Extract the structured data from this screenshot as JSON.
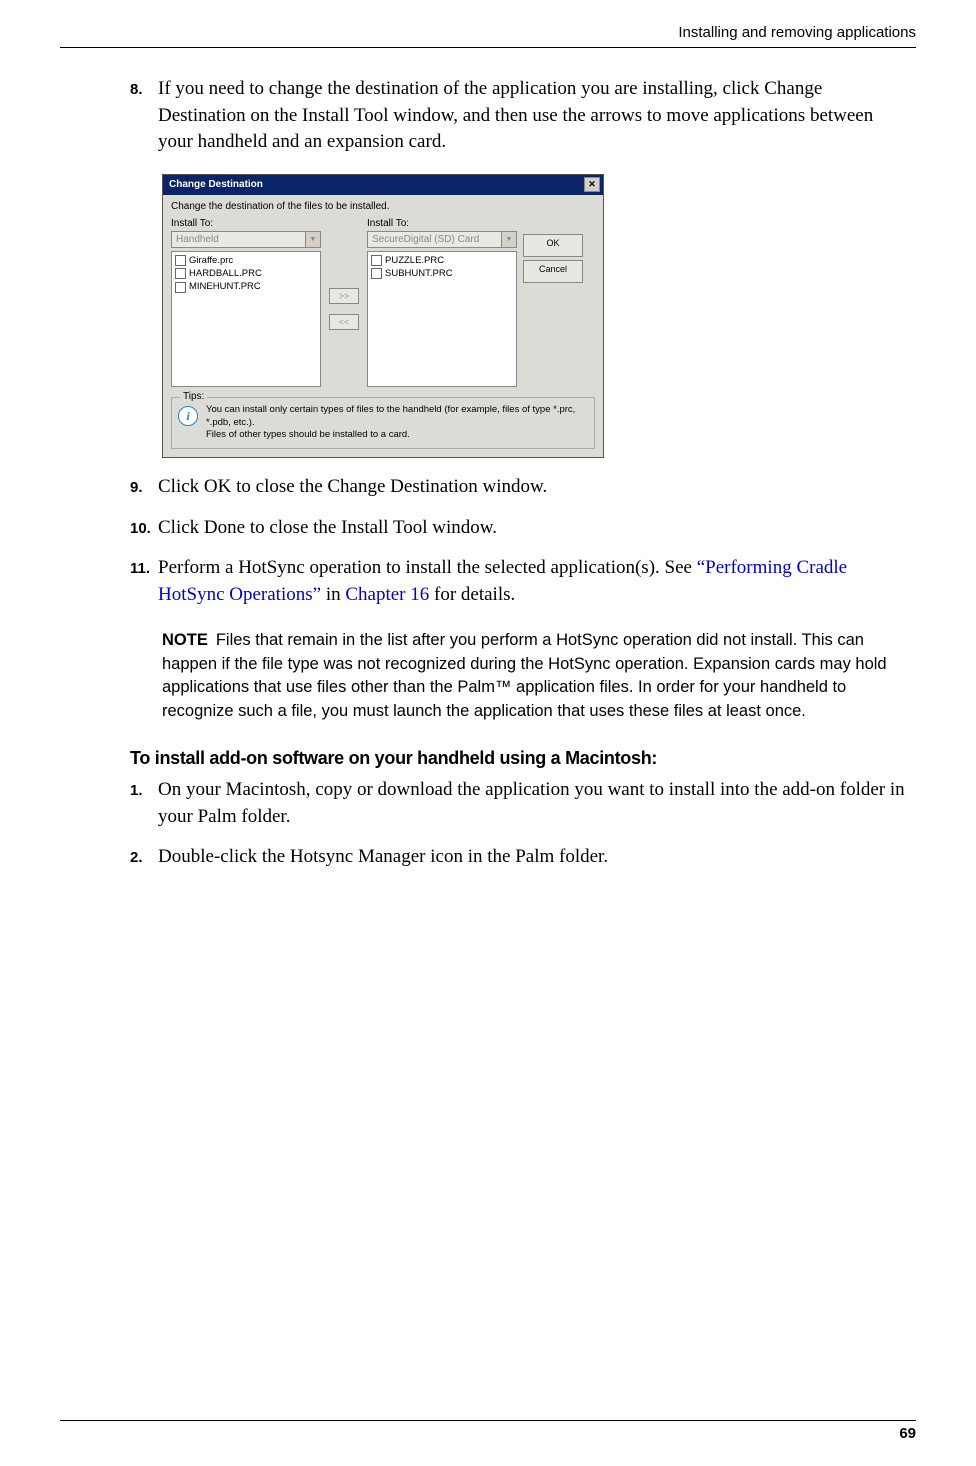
{
  "header": {
    "running_title": "Installing and removing applications"
  },
  "steps_a": [
    {
      "num": "8.",
      "text": "If you need to change the destination of the application you are installing, click Change Destination on the Install Tool window, and then use the arrows to move applications between your handheld and an expansion card."
    }
  ],
  "dialog": {
    "title": "Change Destination",
    "instruction": "Change the destination of the files to be installed.",
    "left_label": "Install To:",
    "right_label": "Install To:",
    "left_combo": "Handheld",
    "right_combo": "SecureDigital (SD) Card",
    "left_files": [
      "Giraffe.prc",
      "HARDBALL.PRC",
      "MINEHUNT.PRC"
    ],
    "right_files": [
      "PUZZLE.PRC",
      "SUBHUNT.PRC"
    ],
    "btn_right": ">>",
    "btn_left": "<<",
    "ok": "OK",
    "cancel": "Cancel",
    "tips_legend": "Tips:",
    "tips_line1": "You can install only certain types of files to the handheld (for example, files of type *.prc, *.pdb, etc.).",
    "tips_line2": "Files of other types should be installed to a card.",
    "close_glyph": "✕"
  },
  "steps_b": [
    {
      "num": "9.",
      "text": "Click OK to close the Change Destination window."
    },
    {
      "num": "10.",
      "text": "Click Done to close the Install Tool window."
    },
    {
      "num": "11.",
      "pre": "Perform a HotSync operation to install the selected application(s). See ",
      "link1": "“Performing Cradle HotSync Operations”",
      "mid": " in ",
      "link2": "Chapter 16",
      "post": " for details."
    }
  ],
  "note": {
    "label": "NOTE",
    "text": "Files that remain in the list after you perform a HotSync operation did not install. This can happen if the file type was not recognized during the HotSync operation. Expansion cards may hold applications that use files other than the Palm™ application files. In order for your handheld to recognize such a file, you must launch the application that uses these files at least once."
  },
  "subheading": "To install add-on software on your handheld using a Macintosh:",
  "steps_c": [
    {
      "num": "1.",
      "text": "On your Macintosh, copy or download the application you want to install into the add-on folder in your Palm folder."
    },
    {
      "num": "2.",
      "text": "Double-click the Hotsync Manager icon in the Palm folder."
    }
  ],
  "footer": {
    "page_number": "69"
  }
}
